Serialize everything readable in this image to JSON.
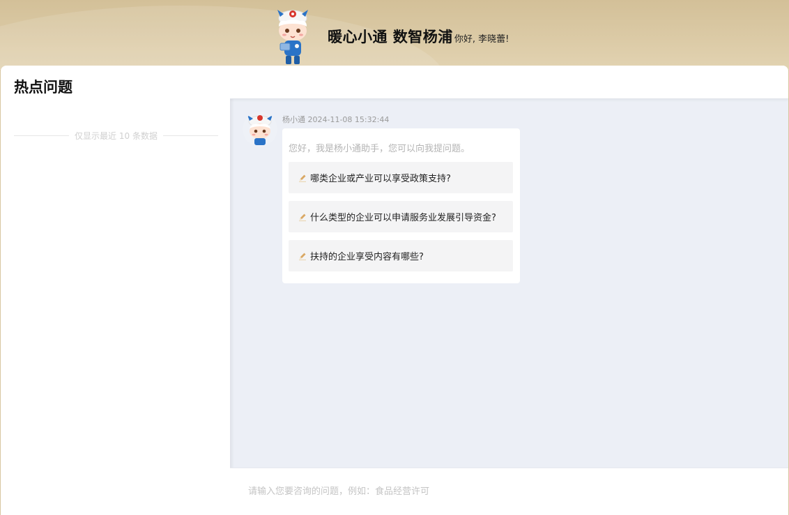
{
  "header": {
    "title": "暖心小通 数智杨浦",
    "greeting": "你好, 李晓蕾!"
  },
  "sidebar": {
    "title": "热点问题",
    "note": "仅显示最近 10 条数据"
  },
  "chat": {
    "message": {
      "sender": "杨小通",
      "timestamp": "2024-11-08 15:32:44",
      "intro": "您好，我是杨小通助手，您可以向我提问题。",
      "suggestions": [
        {
          "text": "哪类企业或产业可以享受政策支持?"
        },
        {
          "text": "什么类型的企业可以申请服务业发展引导资金?"
        },
        {
          "text": "扶持的企业享受内容有哪些?"
        }
      ]
    },
    "input": {
      "placeholder": "请输入您要咨询的问题，例如：食品经营许可",
      "value": ""
    }
  },
  "colors": {
    "header_bg": "#d3c098",
    "chat_bg": "#eceff6",
    "suggestion_bg": "#f4f4f5",
    "pencil_accent": "#d9a864",
    "mascot_blue": "#2a73c7",
    "mascot_red": "#d8362c"
  },
  "icons": {
    "mascot": "mascot-robot-icon",
    "pencil": "pencil-icon"
  }
}
